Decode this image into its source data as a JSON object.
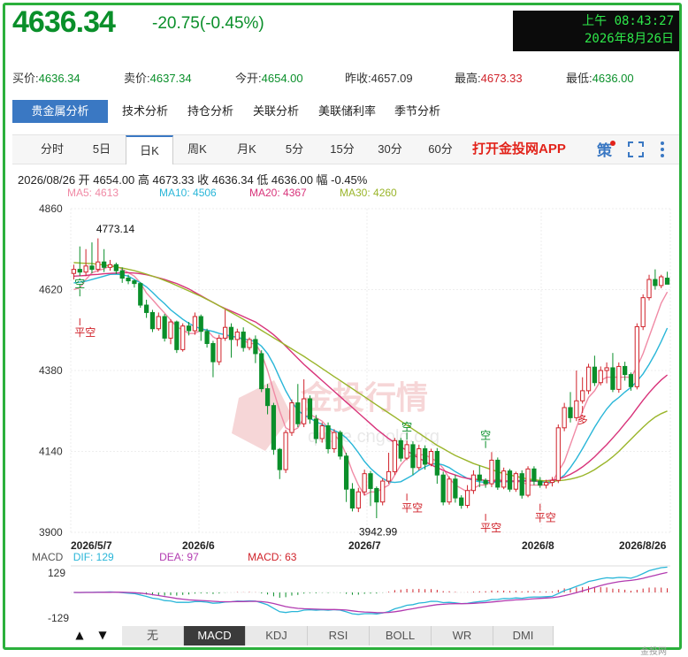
{
  "header": {
    "price": "4636.34",
    "change": "-20.75(-0.45%)",
    "clock_line1": "上午 08:43:27",
    "clock_line2": "2026年8月26日"
  },
  "quote": [
    {
      "label": "买价:",
      "value": "4636.34",
      "color": "green"
    },
    {
      "label": "卖价:",
      "value": "4637.34",
      "color": "green"
    },
    {
      "label": "今开:",
      "value": "4654.00",
      "color": "green"
    },
    {
      "label": "昨收:",
      "value": "4657.09",
      "color": "black"
    },
    {
      "label": "最高:",
      "value": "4673.33",
      "color": "red"
    },
    {
      "label": "最低:",
      "value": "4636.00",
      "color": "green"
    }
  ],
  "analysis_tabs": [
    "贵金属分析",
    "技术分析",
    "持仓分析",
    "关联分析",
    "美联储利率",
    "季节分析"
  ],
  "period_tabs": [
    "分时",
    "5日",
    "日K",
    "周K",
    "月K",
    "5分",
    "15分",
    "30分",
    "60分"
  ],
  "active_period": "日K",
  "app_link": "打开金投网APP",
  "bar_info": "2026/08/26 开 4654.00 高 4673.33 收 4636.34 低 4636.00 幅 -0.45%",
  "ma": [
    {
      "label": "MA5: 4613",
      "color": "#f08aa5"
    },
    {
      "label": "MA10: 4506",
      "color": "#29b6d8"
    },
    {
      "label": "MA20: 4367",
      "color": "#d8337a"
    },
    {
      "label": "MA30: 4260",
      "color": "#9ab52a"
    }
  ],
  "colors": {
    "up": "#d0222a",
    "down": "#0a8f2a",
    "accent": "#3a78c3",
    "border": "#2bb03c"
  },
  "watermark": {
    "cn": "金投行情",
    "en": "quote.cngold.org"
  },
  "chart_data": {
    "type": "candlestick",
    "y_ticks": [
      "4860",
      "4620",
      "4380",
      "4140",
      "3900"
    ],
    "ylim": [
      3900,
      4860
    ],
    "x_ticks": [
      "2026/5/7",
      "2026/6",
      "2026/7",
      "2026/8",
      "2026/8/26"
    ],
    "annotations": {
      "high_label": "4773.14",
      "low_label": "3942.99"
    },
    "signals": [
      "空",
      "平空",
      "空",
      "平空",
      "空",
      "平空",
      "多",
      "平空"
    ],
    "candles": [
      [
        4668,
        4680,
        4650,
        4694
      ],
      [
        4680,
        4672,
        4660,
        4748
      ],
      [
        4672,
        4690,
        4660,
        4740
      ],
      [
        4690,
        4680,
        4668,
        4760
      ],
      [
        4680,
        4702,
        4672,
        4772
      ],
      [
        4702,
        4686,
        4672,
        4740
      ],
      [
        4686,
        4694,
        4676,
        4708
      ],
      [
        4694,
        4676,
        4666,
        4700
      ],
      [
        4676,
        4654,
        4640,
        4686
      ],
      [
        4654,
        4646,
        4636,
        4664
      ],
      [
        4646,
        4638,
        4626,
        4650
      ],
      [
        4638,
        4574,
        4566,
        4642
      ],
      [
        4574,
        4552,
        4536,
        4590
      ],
      [
        4552,
        4504,
        4494,
        4560
      ],
      [
        4504,
        4540,
        4498,
        4552
      ],
      [
        4540,
        4476,
        4466,
        4548
      ],
      [
        4476,
        4524,
        4458,
        4532
      ],
      [
        4524,
        4442,
        4432,
        4528
      ],
      [
        4442,
        4512,
        4436,
        4520
      ],
      [
        4512,
        4498,
        4484,
        4524
      ],
      [
        4498,
        4540,
        4486,
        4552
      ],
      [
        4540,
        4496,
        4468,
        4546
      ],
      [
        4496,
        4460,
        4448,
        4504
      ],
      [
        4460,
        4406,
        4360,
        4468
      ],
      [
        4406,
        4476,
        4396,
        4486
      ],
      [
        4476,
        4508,
        4468,
        4560
      ],
      [
        4508,
        4472,
        4418,
        4520
      ],
      [
        4472,
        4494,
        4452,
        4504
      ],
      [
        4494,
        4448,
        4436,
        4508
      ],
      [
        4448,
        4472,
        4440,
        4478
      ],
      [
        4472,
        4430,
        4402,
        4484
      ],
      [
        4430,
        4326,
        4316,
        4440
      ],
      [
        4326,
        4276,
        4250,
        4340
      ],
      [
        4276,
        4146,
        4130,
        4284
      ],
      [
        4146,
        4086,
        4058,
        4150
      ],
      [
        4086,
        4196,
        4076,
        4204
      ],
      [
        4196,
        4284,
        4186,
        4294
      ],
      [
        4284,
        4222,
        4212,
        4340
      ],
      [
        4222,
        4296,
        4212,
        4354
      ],
      [
        4296,
        4236,
        4222,
        4306
      ],
      [
        4236,
        4178,
        4164,
        4248
      ],
      [
        4178,
        4216,
        4166,
        4226
      ],
      [
        4216,
        4148,
        4134,
        4226
      ],
      [
        4148,
        4196,
        4136,
        4206
      ],
      [
        4196,
        4126,
        4116,
        4202
      ],
      [
        4126,
        4028,
        3990,
        4136
      ],
      [
        4028,
        3972,
        3962,
        4046
      ],
      [
        3972,
        4020,
        3960,
        4032
      ],
      [
        4020,
        4074,
        4010,
        4086
      ],
      [
        4074,
        4030,
        3978,
        4082
      ],
      [
        4030,
        3990,
        3942,
        4036
      ],
      [
        3990,
        4052,
        3980,
        4060
      ],
      [
        4052,
        4080,
        4044,
        4136
      ],
      [
        4080,
        4172,
        4070,
        4180
      ],
      [
        4172,
        4120,
        4110,
        4180
      ],
      [
        4120,
        4160,
        4114,
        4172
      ],
      [
        4160,
        4092,
        4070,
        4170
      ],
      [
        4092,
        4148,
        4084,
        4160
      ],
      [
        4148,
        4102,
        4086,
        4158
      ],
      [
        4102,
        4140,
        4096,
        4148
      ],
      [
        4140,
        4070,
        4044,
        4150
      ],
      [
        4070,
        3990,
        3980,
        4080
      ],
      [
        3990,
        4058,
        3982,
        4066
      ],
      [
        4058,
        4002,
        3988,
        4070
      ],
      [
        4002,
        3980,
        3970,
        4010
      ],
      [
        3980,
        4024,
        3972,
        4040
      ],
      [
        4024,
        4070,
        4014,
        4084
      ],
      [
        4070,
        4054,
        4034,
        4098
      ],
      [
        4054,
        4044,
        4032,
        4060
      ],
      [
        4044,
        4114,
        4034,
        4138
      ],
      [
        4114,
        4034,
        4026,
        4122
      ],
      [
        4034,
        4082,
        4028,
        4092
      ],
      [
        4082,
        4028,
        4020,
        4088
      ],
      [
        4028,
        4074,
        4020,
        4080
      ],
      [
        4074,
        4010,
        4000,
        4084
      ],
      [
        4010,
        4088,
        4004,
        4096
      ],
      [
        4088,
        4052,
        4040,
        4096
      ],
      [
        4052,
        4040,
        4032,
        4064
      ],
      [
        4040,
        4048,
        4030,
        4056
      ],
      [
        4048,
        4054,
        4036,
        4064
      ],
      [
        4054,
        4210,
        4046,
        4220
      ],
      [
        4210,
        4270,
        4200,
        4284
      ],
      [
        4270,
        4240,
        4226,
        4316
      ],
      [
        4240,
        4290,
        4230,
        4380
      ],
      [
        4290,
        4320,
        4282,
        4360
      ],
      [
        4320,
        4390,
        4310,
        4400
      ],
      [
        4390,
        4344,
        4334,
        4424
      ],
      [
        4344,
        4380,
        4336,
        4392
      ],
      [
        4380,
        4388,
        4342,
        4404
      ],
      [
        4388,
        4324,
        4316,
        4432
      ],
      [
        4324,
        4392,
        4314,
        4404
      ],
      [
        4392,
        4368,
        4350,
        4406
      ],
      [
        4368,
        4332,
        4320,
        4374
      ],
      [
        4332,
        4510,
        4324,
        4520
      ],
      [
        4510,
        4596,
        4500,
        4606
      ],
      [
        4596,
        4650,
        4588,
        4664
      ],
      [
        4650,
        4632,
        4620,
        4680
      ],
      [
        4632,
        4658,
        4624,
        4664
      ],
      [
        4654,
        4636,
        4636,
        4673
      ]
    ],
    "ma_series": {
      "MA5": [
        4620,
        4625,
        4650,
        4670,
        4676,
        4682,
        4690,
        4690,
        4680,
        4670,
        4660,
        4640,
        4610,
        4590,
        4570,
        4550,
        4530,
        4510,
        4500,
        4490,
        4490,
        4500,
        4500,
        4480,
        4470,
        4480,
        4480,
        4480,
        4470,
        4460,
        4460,
        4430,
        4380,
        4320,
        4260,
        4210,
        4200,
        4210,
        4240,
        4250,
        4240,
        4230,
        4210,
        4190,
        4170,
        4130,
        4080,
        4040,
        4010,
        4020,
        4020,
        4030,
        4040,
        4070,
        4100,
        4120,
        4130,
        4130,
        4130,
        4120,
        4110,
        4090,
        4060,
        4040,
        4030,
        4020,
        4030,
        4040,
        4040,
        4050,
        4060,
        4050,
        4050,
        4050,
        4050,
        4040,
        4040,
        4040,
        4040,
        4050,
        4080,
        4110,
        4160,
        4210,
        4260,
        4300,
        4320,
        4350,
        4360,
        4360,
        4360,
        4360,
        4360,
        4390,
        4430,
        4480,
        4530,
        4580,
        4613
      ],
      "MA10": [
        4640,
        4642,
        4645,
        4650,
        4655,
        4660,
        4665,
        4666,
        4664,
        4660,
        4650,
        4640,
        4628,
        4612,
        4594,
        4578,
        4560,
        4546,
        4532,
        4520,
        4510,
        4504,
        4500,
        4496,
        4490,
        4486,
        4482,
        4478,
        4474,
        4470,
        4466,
        4452,
        4430,
        4398,
        4358,
        4320,
        4288,
        4262,
        4248,
        4238,
        4228,
        4220,
        4210,
        4202,
        4194,
        4180,
        4160,
        4136,
        4110,
        4090,
        4074,
        4060,
        4050,
        4048,
        4050,
        4060,
        4070,
        4084,
        4094,
        4102,
        4104,
        4100,
        4092,
        4080,
        4070,
        4060,
        4054,
        4050,
        4048,
        4048,
        4050,
        4050,
        4050,
        4052,
        4054,
        4054,
        4052,
        4050,
        4048,
        4048,
        4056,
        4070,
        4092,
        4118,
        4148,
        4180,
        4212,
        4240,
        4266,
        4286,
        4300,
        4316,
        4330,
        4348,
        4370,
        4398,
        4430,
        4466,
        4506
      ],
      "MA20": [
        4660,
        4661,
        4662,
        4664,
        4665,
        4667,
        4668,
        4669,
        4670,
        4670,
        4669,
        4667,
        4664,
        4660,
        4655,
        4650,
        4644,
        4638,
        4630,
        4622,
        4612,
        4602,
        4592,
        4582,
        4572,
        4564,
        4556,
        4548,
        4540,
        4532,
        4524,
        4512,
        4500,
        4486,
        4470,
        4452,
        4434,
        4416,
        4398,
        4382,
        4366,
        4350,
        4334,
        4318,
        4302,
        4286,
        4270,
        4254,
        4238,
        4222,
        4206,
        4192,
        4178,
        4166,
        4154,
        4142,
        4130,
        4120,
        4110,
        4100,
        4092,
        4084,
        4076,
        4070,
        4064,
        4060,
        4058,
        4056,
        4054,
        4052,
        4052,
        4052,
        4052,
        4052,
        4052,
        4052,
        4052,
        4052,
        4053,
        4055,
        4058,
        4064,
        4072,
        4082,
        4094,
        4108,
        4124,
        4142,
        4160,
        4180,
        4200,
        4222,
        4244,
        4268,
        4292,
        4314,
        4334,
        4352,
        4367
      ],
      "MA30": [
        4700,
        4699,
        4698,
        4697,
        4695,
        4693,
        4690,
        4687,
        4684,
        4680,
        4676,
        4671,
        4666,
        4660,
        4654,
        4647,
        4640,
        4632,
        4624,
        4616,
        4608,
        4600,
        4591,
        4582,
        4572,
        4562,
        4552,
        4542,
        4532,
        4521,
        4510,
        4499,
        4488,
        4477,
        4466,
        4455,
        4444,
        4433,
        4422,
        4410,
        4398,
        4386,
        4374,
        4362,
        4350,
        4338,
        4326,
        4314,
        4302,
        4290,
        4278,
        4266,
        4254,
        4242,
        4230,
        4218,
        4206,
        4194,
        4182,
        4170,
        4158,
        4148,
        4138,
        4128,
        4120,
        4112,
        4104,
        4098,
        4092,
        4086,
        4080,
        4074,
        4070,
        4066,
        4062,
        4058,
        4056,
        4054,
        4052,
        4052,
        4053,
        4055,
        4058,
        4062,
        4068,
        4076,
        4086,
        4098,
        4110,
        4124,
        4140,
        4158,
        4176,
        4194,
        4212,
        4228,
        4242,
        4252,
        4260
      ]
    }
  },
  "macd": {
    "labels": [
      {
        "text": "MACD",
        "color": "#555555"
      },
      {
        "text": "DIF: 129",
        "color": "#29b6d8"
      },
      {
        "text": "DEA: 97",
        "color": "#b23ab0"
      },
      {
        "text": "MACD: 63",
        "color": "#d0222a"
      }
    ],
    "y_ticks": [
      "129",
      "-129"
    ]
  },
  "indicator_tabs": [
    "无",
    "MACD",
    "KDJ",
    "RSI",
    "BOLL",
    "WR",
    "DMI"
  ],
  "active_indicator": "MACD",
  "footer_text": "金投网"
}
